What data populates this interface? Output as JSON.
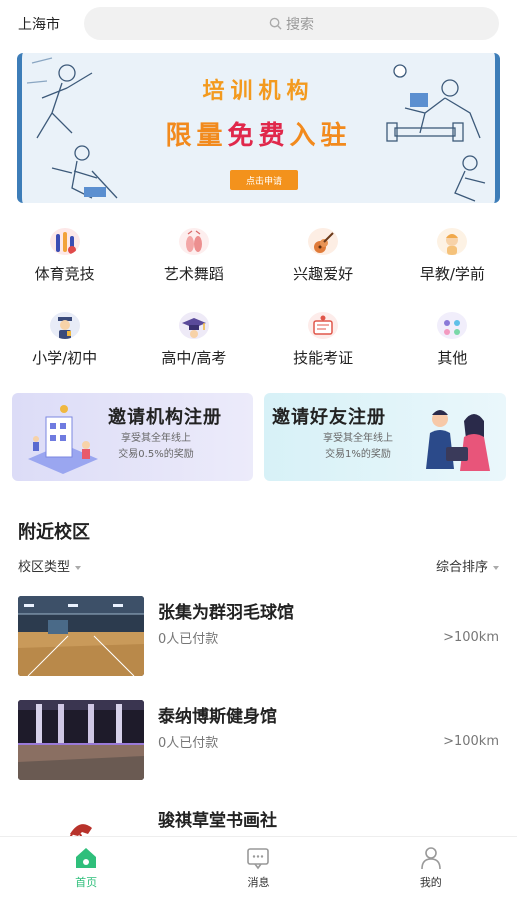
{
  "header": {
    "city": "上海市",
    "search_placeholder": "搜索"
  },
  "banner": {
    "line1": "培训机构",
    "line2_a": "限量",
    "line2_hl": "免费",
    "line2_b": "入驻",
    "button": "点击申请"
  },
  "categories": [
    {
      "label": "体育竞技",
      "icon": "sports-icon",
      "color": "#3b4db3"
    },
    {
      "label": "艺术舞蹈",
      "icon": "ballet-shoes-icon",
      "color": "#f3a6a6"
    },
    {
      "label": "兴趣爱好",
      "icon": "guitar-icon",
      "color": "#e07b39"
    },
    {
      "label": "早教/学前",
      "icon": "baby-icon",
      "color": "#f5c27a"
    },
    {
      "label": "小学/初中",
      "icon": "student-icon",
      "color": "#3a4a7a"
    },
    {
      "label": "高中/高考",
      "icon": "graduation-cap-icon",
      "color": "#5a4a9a"
    },
    {
      "label": "技能考证",
      "icon": "certificate-icon",
      "color": "#e0564a"
    },
    {
      "label": "其他",
      "icon": "dots-icon",
      "color": "#8a7ad8"
    }
  ],
  "invites": [
    {
      "title": "邀请机构注册",
      "desc1": "享受其全年线上",
      "desc2": "交易0.5%的奖励"
    },
    {
      "title": "邀请好友注册",
      "desc1": "享受其全年线上",
      "desc2": "交易1%的奖励"
    }
  ],
  "nearby": {
    "title": "附近校区",
    "filter_left": "校区类型",
    "filter_right": "综合排序",
    "venues": [
      {
        "name": "张集为群羽毛球馆",
        "paid": "0人已付款",
        "distance": ">100km"
      },
      {
        "name": "泰纳博斯健身馆",
        "paid": "0人已付款",
        "distance": ">100km"
      },
      {
        "name": "骏祺草堂书画社",
        "paid": "",
        "distance": ""
      }
    ]
  },
  "tabbar": [
    {
      "label": "首页",
      "icon": "home-icon",
      "active": true
    },
    {
      "label": "消息",
      "icon": "message-icon",
      "active": false
    },
    {
      "label": "我的",
      "icon": "user-icon",
      "active": false
    }
  ],
  "colors": {
    "accent": "#2fbf7b",
    "banner_orange": "#f28a1d",
    "banner_red": "#e0284b"
  }
}
